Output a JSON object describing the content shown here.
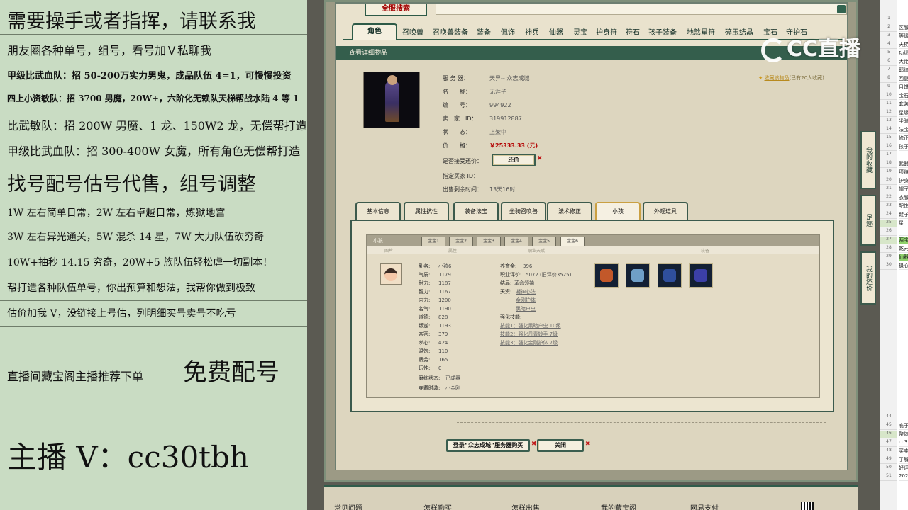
{
  "overlay": {
    "lines": [
      "需要操手或者指挥，请联系我",
      "朋友圈各种单号，组号，看号加Ｖ私聊我",
      "甲级比武血队：招 50-200万实力男鬼，成品队伍 4=1，可慢慢投资",
      "四上小资敏队：招 3700 男魔，20W+，六阶化无赖队天梯帮战水陆 4 等 1",
      "比武敏队：招 200W 男魔、1 龙、150W2 龙，无偿帮打造",
      "甲级比武血队：招 300-400W 女魔，所有角色无偿帮打造",
      "找号配号估号代售，组号调整",
      "1W 左右简单日常，2W 左右卓越日常，炼狱地宫",
      "3W 左右异光通关，5W 混杀 14 星，7W 大力队伍砍穷奇",
      "10W+抽秒 14.15 穷奇，20W+5 族队伍轻松虐一切副本！",
      "帮打造各种队伍单号，你出预算和想法，我帮你做到极致",
      "估价加我 V，没链接上号估，列明细买号卖号不吃亏",
      "直播间藏宝阁主播推荐下单",
      "免费配号",
      "主播 V：cc30tbh"
    ]
  },
  "site": {
    "logo": "全服搜索",
    "categories": [
      "角色",
      "召唤兽",
      "召唤兽装备",
      "装备",
      "佩饰",
      "神兵",
      "仙器",
      "灵宝",
      "护身符",
      "符石",
      "孩子装备",
      "地煞星符",
      "碎玉结晶",
      "宝石",
      "守护石"
    ],
    "active_category": "角色",
    "panel_title": "查看详细物品"
  },
  "item": {
    "rows": [
      {
        "k": "服 务 器：",
        "v": "天界-- 众志成城"
      },
      {
        "k": "名　　称：",
        "v": "无涯子"
      },
      {
        "k": "编　　号：",
        "v": "994922"
      },
      {
        "k": "卖　家　ID：",
        "v": "319912887"
      },
      {
        "k": "状　　态：",
        "v": "上架中"
      },
      {
        "k": "价　　格：",
        "v": "￥25333.33 (元)"
      },
      {
        "k": "是否接受还价：",
        "v": ""
      },
      {
        "k": "指定买家 ID：",
        "v": ""
      },
      {
        "k": "出售剩余时间：",
        "v": "13天16时"
      }
    ],
    "counter_offer_button": "还价",
    "favorite_link": "收藏该物品",
    "favorite_count": "(已有20人收藏)"
  },
  "sub_tabs": [
    "基本信息",
    "属性抗性",
    "装备法宝",
    "坐骑召唤兽",
    "法术修正",
    "小孩",
    "外观道具"
  ],
  "active_sub_tab": "小孩",
  "child_panel": {
    "title": "小孩",
    "baby_tabs": [
      "宝宝1",
      "宝宝2",
      "宝宝3",
      "宝宝4",
      "宝宝5",
      "宝宝6"
    ],
    "active_baby_tab": "宝宝6",
    "columns": [
      "图片",
      "属性",
      "职业天赋",
      "装备"
    ],
    "stats": [
      {
        "k": "乳名:",
        "v": "小孩6"
      },
      {
        "k": "气质:",
        "v": "1179"
      },
      {
        "k": "耐力:",
        "v": "1187"
      },
      {
        "k": "智力:",
        "v": "1167"
      },
      {
        "k": "内力:",
        "v": "1200"
      },
      {
        "k": "名气:",
        "v": "1190"
      },
      {
        "k": "道德:",
        "v": "828"
      },
      {
        "k": "叛逆:",
        "v": "1193"
      },
      {
        "k": "亲密:",
        "v": "379"
      },
      {
        "k": "孝心:",
        "v": "424"
      },
      {
        "k": "温饱:",
        "v": "110"
      },
      {
        "k": "疲劳:",
        "v": "165"
      },
      {
        "k": "玩性:",
        "v": "0"
      }
    ],
    "extra": [
      {
        "k": "磨练状态:",
        "v": "已成器"
      },
      {
        "k": "穿戴时装:",
        "v": "小金刚"
      }
    ],
    "career": [
      {
        "k": "养育金:",
        "v": "396"
      },
      {
        "k": "职业评价:",
        "v": "5072 (旧评价3525)"
      },
      {
        "k": "结局:",
        "v": "革命领袖"
      },
      {
        "k": "天资:",
        "v": "凝神心法"
      }
    ],
    "talents_more": [
      "金刚护体",
      "黑暗户虫"
    ],
    "strengthen_title": "强化技能:",
    "strengthen": [
      "技能1：强化黑暗户虫 10级",
      "技能2：强化丹青妙手 7级",
      "技能3：强化金刚护体 7级"
    ]
  },
  "buttons": {
    "buy": "登录“众志成城”服务器购买",
    "close": "关闭"
  },
  "footer": [
    "常见问题",
    "怎样购买",
    "怎样出售",
    "我的藏宝阁",
    "网易支付"
  ],
  "side_buttons": [
    "我的收藏",
    "足迹",
    "我的还价"
  ],
  "watermark": "CC直播",
  "sheet": {
    "rows": [
      {
        "n": "1",
        "c": ""
      },
      {
        "n": "2",
        "c": "区服"
      },
      {
        "n": "3",
        "c": "等级"
      },
      {
        "n": "4",
        "c": "天梯"
      },
      {
        "n": "5",
        "c": "功绩"
      },
      {
        "n": "6",
        "c": "大佬"
      },
      {
        "n": "7",
        "c": "耶律"
      },
      {
        "n": "8",
        "c": "回复"
      },
      {
        "n": "9",
        "c": "月饼"
      },
      {
        "n": "10",
        "c": "宝石"
      },
      {
        "n": "11",
        "c": "套装"
      },
      {
        "n": "12",
        "c": "星级"
      },
      {
        "n": "13",
        "c": "坐骑"
      },
      {
        "n": "14",
        "c": "法宝"
      },
      {
        "n": "15",
        "c": "修正"
      },
      {
        "n": "16",
        "c": "孩子"
      },
      {
        "n": "17",
        "c": ""
      },
      {
        "n": "18",
        "c": "武器"
      },
      {
        "n": "19",
        "c": "项链"
      },
      {
        "n": "20",
        "c": "护身"
      },
      {
        "n": "21",
        "c": "帽子"
      },
      {
        "n": "22",
        "c": "衣服"
      },
      {
        "n": "23",
        "c": "配饰"
      },
      {
        "n": "24",
        "c": "鞋子"
      },
      {
        "n": "25",
        "c": "星"
      },
      {
        "n": "26",
        "c": ""
      },
      {
        "n": "27",
        "c": "两宝"
      },
      {
        "n": "28",
        "c": "乾元"
      },
      {
        "n": "29",
        "c": "仙器"
      },
      {
        "n": "30",
        "c": "摄心"
      }
    ],
    "bottom_rows": [
      {
        "n": "44",
        "c": ""
      },
      {
        "n": "45",
        "c": "底子"
      },
      {
        "n": "46",
        "c": "整体"
      },
      {
        "n": "47",
        "c": "cc3"
      },
      {
        "n": "48",
        "c": "买卖"
      },
      {
        "n": "49",
        "c": "了解"
      },
      {
        "n": "50",
        "c": "好评"
      },
      {
        "n": "51",
        "c": "202"
      }
    ]
  }
}
